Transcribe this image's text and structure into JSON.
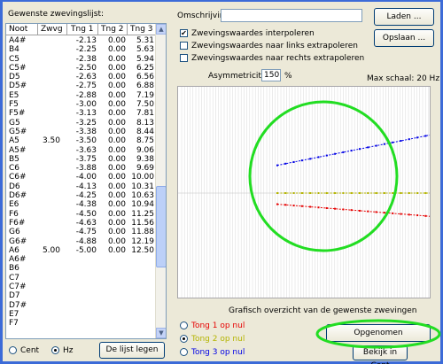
{
  "list": {
    "label": "Gewenste zwevingslijst:",
    "columns": [
      "Noot",
      "Zwvg",
      "Tng 1",
      "Tng 2",
      "Tng 3"
    ],
    "rows": [
      [
        "A4#",
        "",
        "-2.13",
        "0.00",
        "5.31"
      ],
      [
        "B4",
        "",
        "-2.25",
        "0.00",
        "5.63"
      ],
      [
        "C5",
        "",
        "-2.38",
        "0.00",
        "5.94"
      ],
      [
        "C5#",
        "",
        "-2.50",
        "0.00",
        "6.25"
      ],
      [
        "D5",
        "",
        "-2.63",
        "0.00",
        "6.56"
      ],
      [
        "D5#",
        "",
        "-2.75",
        "0.00",
        "6.88"
      ],
      [
        "E5",
        "",
        "-2.88",
        "0.00",
        "7.19"
      ],
      [
        "F5",
        "",
        "-3.00",
        "0.00",
        "7.50"
      ],
      [
        "F5#",
        "",
        "-3.13",
        "0.00",
        "7.81"
      ],
      [
        "G5",
        "",
        "-3.25",
        "0.00",
        "8.13"
      ],
      [
        "G5#",
        "",
        "-3.38",
        "0.00",
        "8.44"
      ],
      [
        "A5",
        "3.50",
        "-3.50",
        "0.00",
        "8.75"
      ],
      [
        "A5#",
        "",
        "-3.63",
        "0.00",
        "9.06"
      ],
      [
        "B5",
        "",
        "-3.75",
        "0.00",
        "9.38"
      ],
      [
        "C6",
        "",
        "-3.88",
        "0.00",
        "9.69"
      ],
      [
        "C6#",
        "",
        "-4.00",
        "0.00",
        "10.00"
      ],
      [
        "D6",
        "",
        "-4.13",
        "0.00",
        "10.31"
      ],
      [
        "D6#",
        "",
        "-4.25",
        "0.00",
        "10.63"
      ],
      [
        "E6",
        "",
        "-4.38",
        "0.00",
        "10.94"
      ],
      [
        "F6",
        "",
        "-4.50",
        "0.00",
        "11.25"
      ],
      [
        "F6#",
        "",
        "-4.63",
        "0.00",
        "11.56"
      ],
      [
        "G6",
        "",
        "-4.75",
        "0.00",
        "11.88"
      ],
      [
        "G6#",
        "",
        "-4.88",
        "0.00",
        "12.19"
      ],
      [
        "A6",
        "5.00",
        "-5.00",
        "0.00",
        "12.50"
      ],
      [
        "A6#",
        "",
        "",
        "",
        ""
      ],
      [
        "B6",
        "",
        "",
        "",
        ""
      ],
      [
        "C7",
        "",
        "",
        "",
        ""
      ],
      [
        "C7#",
        "",
        "",
        "",
        ""
      ],
      [
        "D7",
        "",
        "",
        "",
        ""
      ],
      [
        "D7#",
        "",
        "",
        "",
        ""
      ],
      [
        "E7",
        "",
        "",
        "",
        ""
      ],
      [
        "F7",
        "",
        "",
        "",
        ""
      ]
    ]
  },
  "units": {
    "cent_label": "Cent",
    "hz_label": "Hz",
    "selected": "Hz"
  },
  "clear_button": "De lijst legen",
  "omschrijving": {
    "label": "Omschrijving:",
    "value": ""
  },
  "load_button": "Laden ...",
  "save_button": "Opslaan ...",
  "options": {
    "interpolate": "Zwevingswaardes interpoleren",
    "extrapolate_left": "Zwevingswaardes naar links extrapoleren",
    "extrapolate_right": "Zwevingswaardes naar rechts extrapoleren",
    "interpolate_checked": true,
    "extrapolate_left_checked": false,
    "extrapolate_right_checked": false
  },
  "asymmetry": {
    "label": "Asymmetriciteit",
    "value": "150",
    "unit": "%"
  },
  "max_scale": "Max schaal: 20 Hz",
  "graph_caption": "Grafisch overzicht van de gewenste zwevingen",
  "tongs": {
    "tong1": "Tong 1 op nul",
    "tong2": "Tong 2 op nul",
    "tong3": "Tong 3 op nul",
    "selected": "tong2",
    "colors": {
      "tong1": "#e60000",
      "tong2": "#b4b400",
      "tong3": "#0000e6"
    }
  },
  "accept_button": "Opgenomen",
  "view_cent_button": "Bekijk in Cent",
  "highlight_color": "#22dd22"
}
